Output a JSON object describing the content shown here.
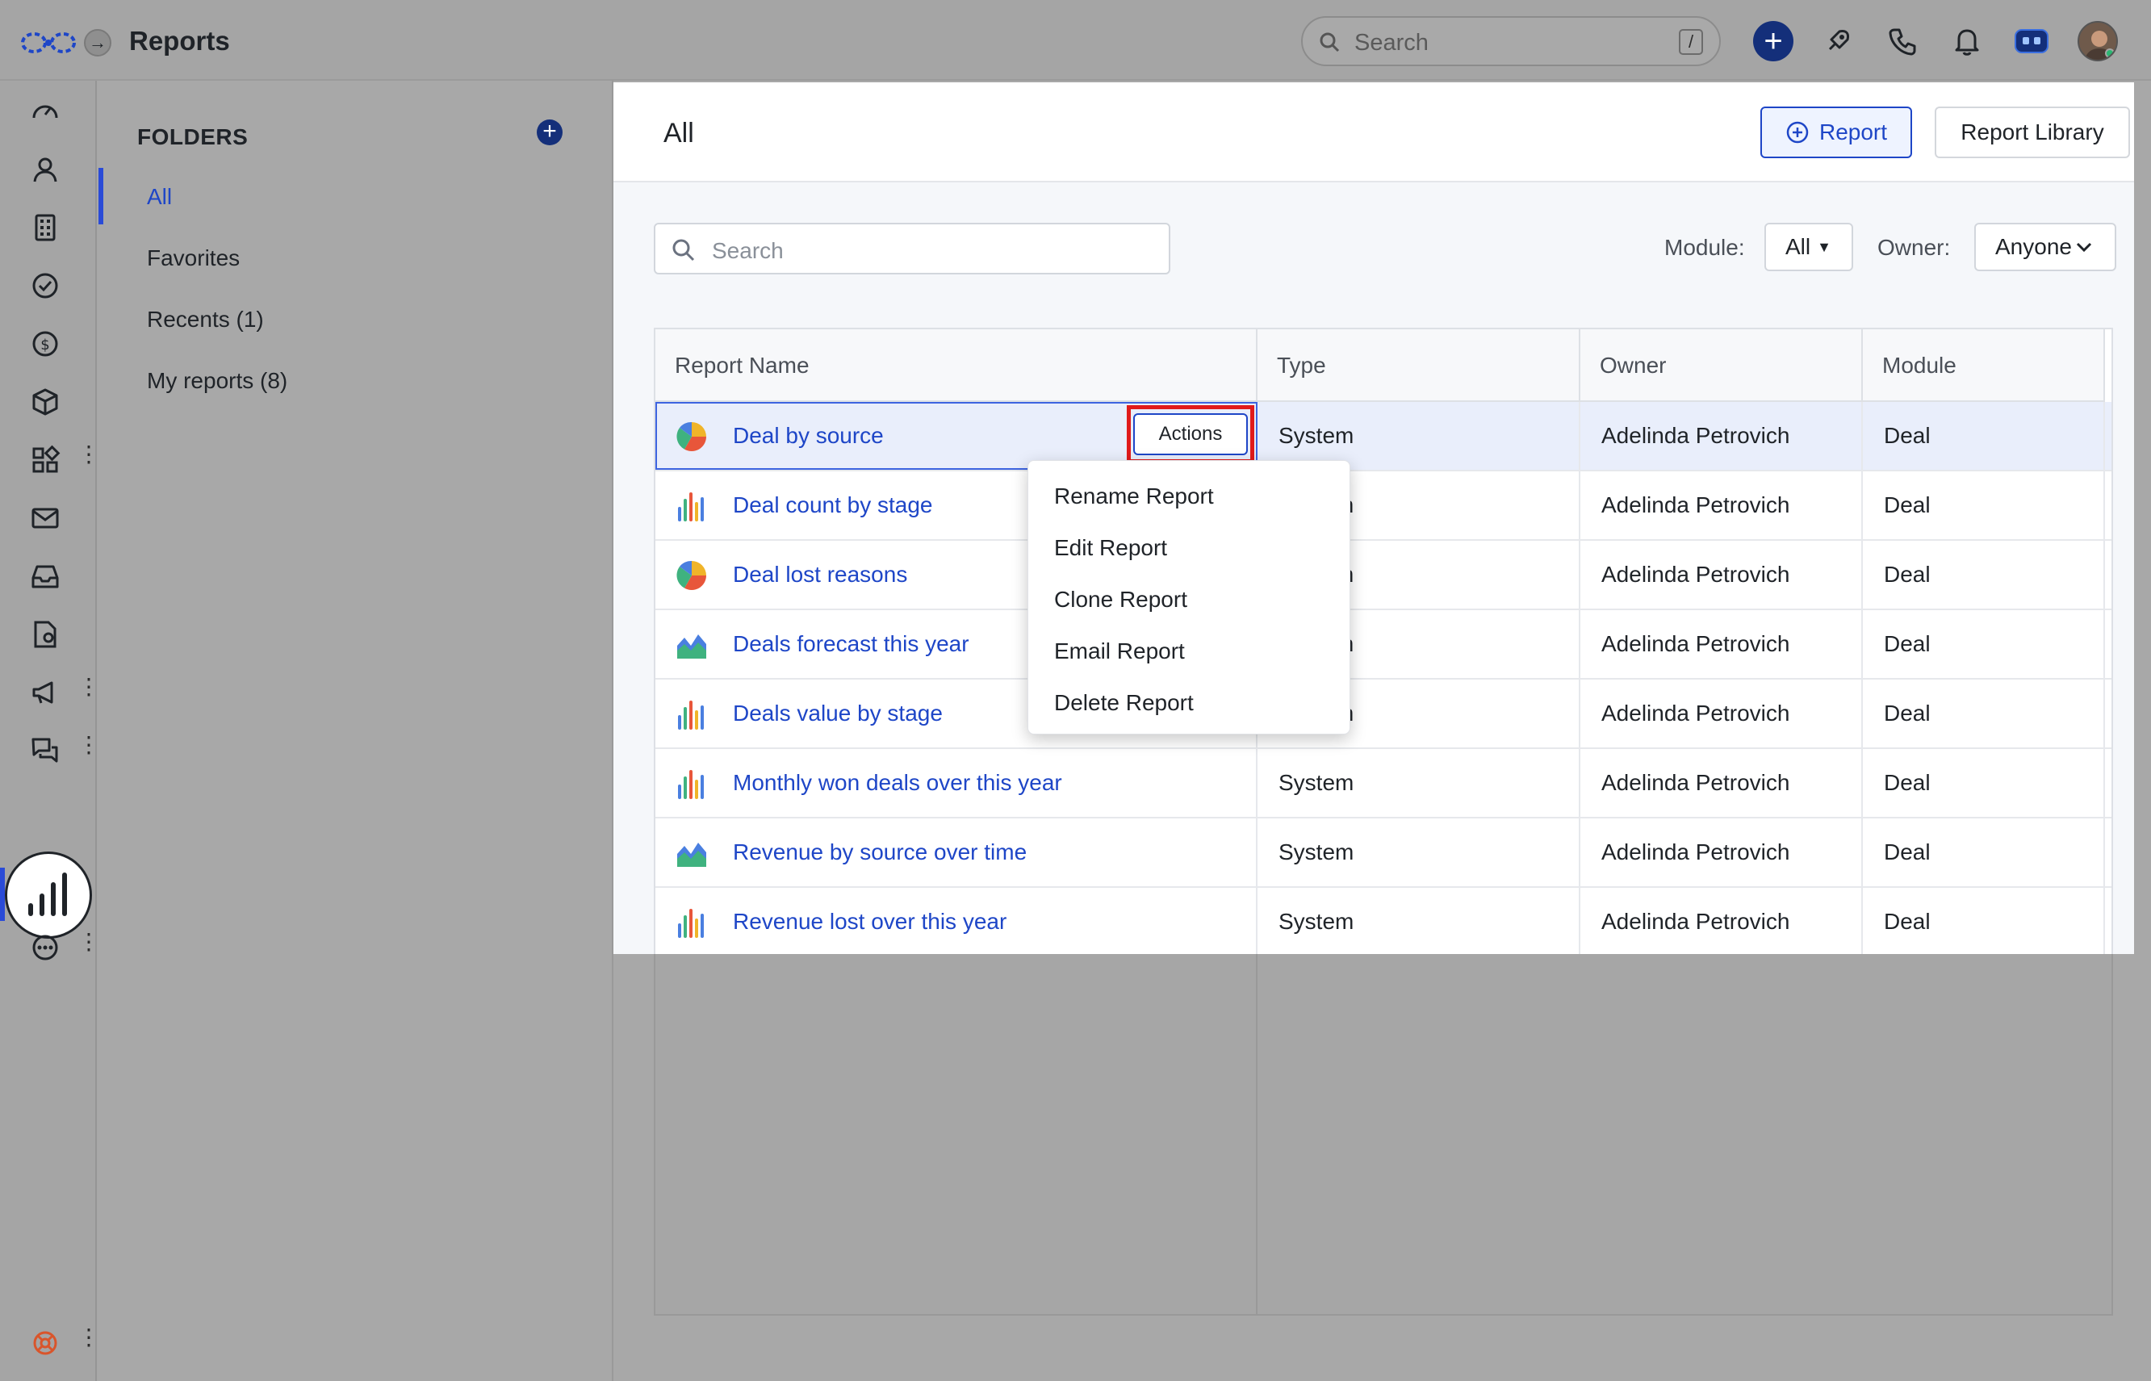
{
  "app": {
    "page_title": "Reports"
  },
  "topbar": {
    "search_placeholder": "Search",
    "search_shortcut": "/"
  },
  "folders": {
    "title": "FOLDERS",
    "items": [
      {
        "label": "All",
        "active": true
      },
      {
        "label": "Favorites"
      },
      {
        "label": "Recents (1)"
      },
      {
        "label": "My reports (8)"
      }
    ]
  },
  "main": {
    "title": "All",
    "report_button": "Report",
    "library_button": "Report Library",
    "search_placeholder": "Search",
    "module_label": "Module:",
    "module_value": "All",
    "owner_label": "Owner:",
    "owner_value": "Anyone"
  },
  "table": {
    "columns": [
      "Report Name",
      "Type",
      "Owner",
      "Module"
    ],
    "rows": [
      {
        "name": "Deal by source",
        "type": "System",
        "owner": "Adelinda Petrovich",
        "module": "Deal",
        "icon": "pie-chart-icon"
      },
      {
        "name": "Deal count by stage",
        "type": "System",
        "owner": "Adelinda Petrovich",
        "module": "Deal",
        "icon": "bar-chart-icon"
      },
      {
        "name": "Deal lost reasons",
        "type": "System",
        "owner": "Adelinda Petrovich",
        "module": "Deal",
        "icon": "pie-chart-icon"
      },
      {
        "name": "Deals forecast this year",
        "type": "System",
        "owner": "Adelinda Petrovich",
        "module": "Deal",
        "icon": "area-chart-icon"
      },
      {
        "name": "Deals value by stage",
        "type": "System",
        "owner": "Adelinda Petrovich",
        "module": "Deal",
        "icon": "bar-chart-icon"
      },
      {
        "name": "Monthly won deals over this year",
        "type": "System",
        "owner": "Adelinda Petrovich",
        "module": "Deal",
        "icon": "bar-chart-icon"
      },
      {
        "name": "Revenue by source over time",
        "type": "System",
        "owner": "Adelinda Petrovich",
        "module": "Deal",
        "icon": "area-chart-icon"
      },
      {
        "name": "Revenue lost over this year",
        "type": "System",
        "owner": "Adelinda Petrovich",
        "module": "Deal",
        "icon": "bar-chart-icon"
      }
    ],
    "actions_label": "Actions"
  },
  "actions_menu": {
    "items": [
      "Rename Report",
      "Edit Report",
      "Clone Report",
      "Email Report",
      "Delete Report"
    ]
  },
  "colors": {
    "accent": "#1e46c7",
    "highlight": "#e01a1a",
    "brand_dark": "#142f7a"
  }
}
